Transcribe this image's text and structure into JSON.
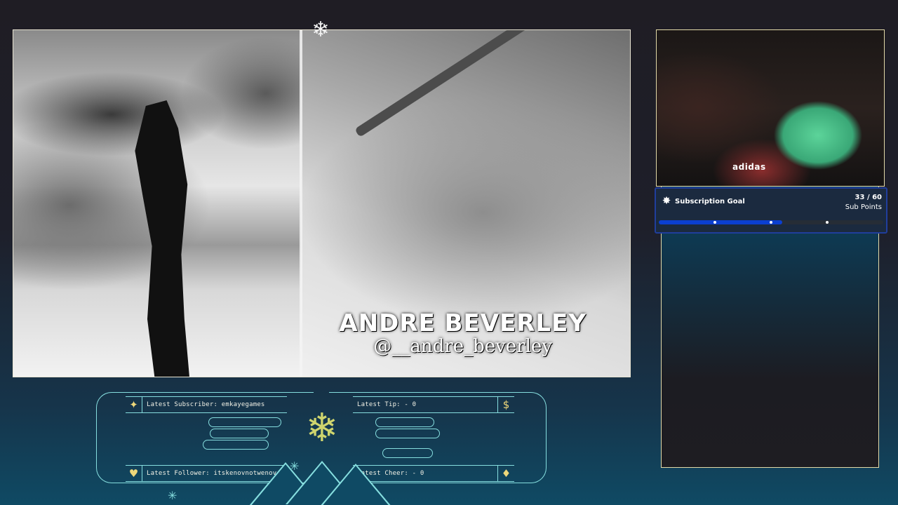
{
  "video": {
    "caption_name": "ANDRE BEVERLEY",
    "caption_handle": "@__andre_beverley"
  },
  "webcam": {
    "hat_brand": "adidas"
  },
  "goal": {
    "title": "Subscription Goal",
    "count": "33 / 60",
    "unit": "Sub Points",
    "progress": 0.55,
    "icon": "star-badge-icon",
    "bar_color": "#0b3fd1"
  },
  "info": {
    "latest_subscriber": "Latest Subscriber: emkayegames",
    "latest_tip": "Latest Tip:  - 0",
    "latest_follower": "Latest Follower: itskenovnotwenov",
    "latest_cheer": "Latest Cheer:  - 0",
    "subscriber_icon": "sparkle-icon",
    "tip_icon": "dollar-icon",
    "follower_icon": "heart-icon",
    "cheer_icon": "diamond-icon",
    "accent_color": "#86dedf",
    "gold_color": "#eed77a"
  }
}
